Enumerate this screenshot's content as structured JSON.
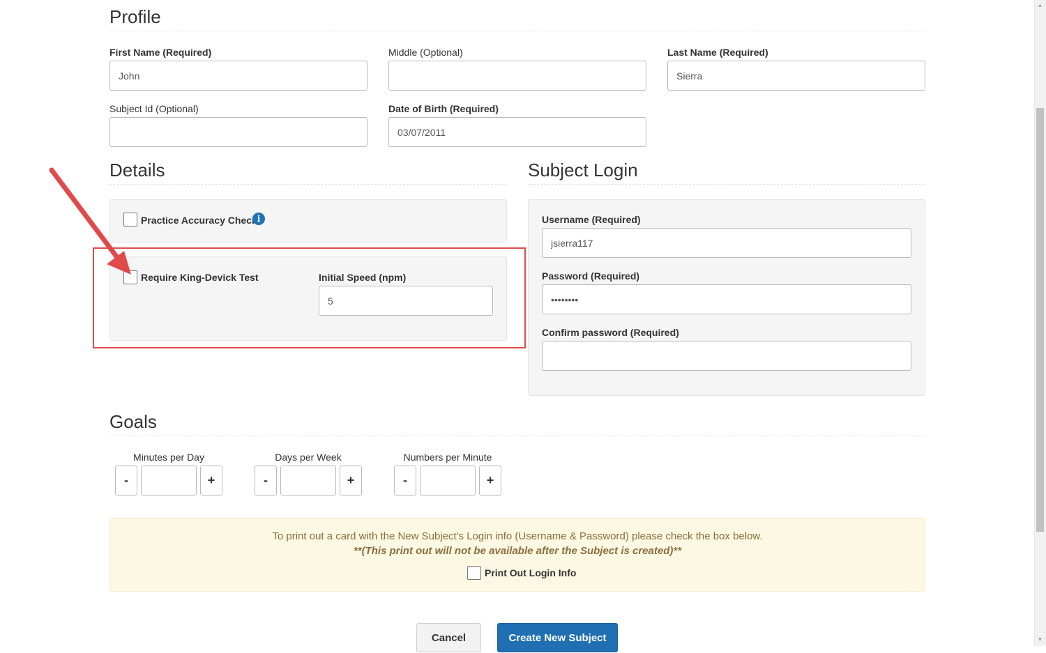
{
  "profile": {
    "heading": "Profile",
    "first_name": {
      "label": "First Name (Required)",
      "value": "John"
    },
    "middle": {
      "label": "Middle (Optional)",
      "value": ""
    },
    "last_name": {
      "label": "Last Name (Required)",
      "value": "Sierra"
    },
    "subject_id": {
      "label": "Subject Id (Optional)",
      "value": ""
    },
    "dob": {
      "label": "Date of Birth (Required)",
      "value": "03/07/2011"
    }
  },
  "details": {
    "heading": "Details",
    "practice_accuracy": {
      "label": "Practice Accuracy Check",
      "checked": false,
      "info_icon": "info-icon"
    },
    "king_devick": {
      "label": "Require King-Devick Test",
      "checked": false
    },
    "initial_speed": {
      "label": "Initial Speed (npm)",
      "value": "5"
    }
  },
  "subject_login": {
    "heading": "Subject Login",
    "username": {
      "label": "Username (Required)",
      "value": "jsierra117"
    },
    "password": {
      "label": "Password (Required)",
      "value": "••••••••"
    },
    "confirm_password": {
      "label": "Confirm password (Required)",
      "value": ""
    }
  },
  "goals": {
    "heading": "Goals",
    "items": [
      {
        "label": "Minutes per Day",
        "minus": "-",
        "plus": "+",
        "value": ""
      },
      {
        "label": "Days per Week",
        "minus": "-",
        "plus": "+",
        "value": ""
      },
      {
        "label": "Numbers per Minute",
        "minus": "-",
        "plus": "+",
        "value": ""
      }
    ]
  },
  "notice": {
    "line1": "To print out a card with the New Subject's Login info (Username & Password) please check the box below.",
    "line2": "**(This print out will not be available after the Subject is created)**",
    "print_label": "Print Out Login Info",
    "checked": false
  },
  "actions": {
    "cancel": "Cancel",
    "create": "Create New Subject"
  },
  "colors": {
    "annotation": "#e04a4a",
    "primary": "#1f6fb2",
    "notice_bg": "#fcf8e3"
  }
}
